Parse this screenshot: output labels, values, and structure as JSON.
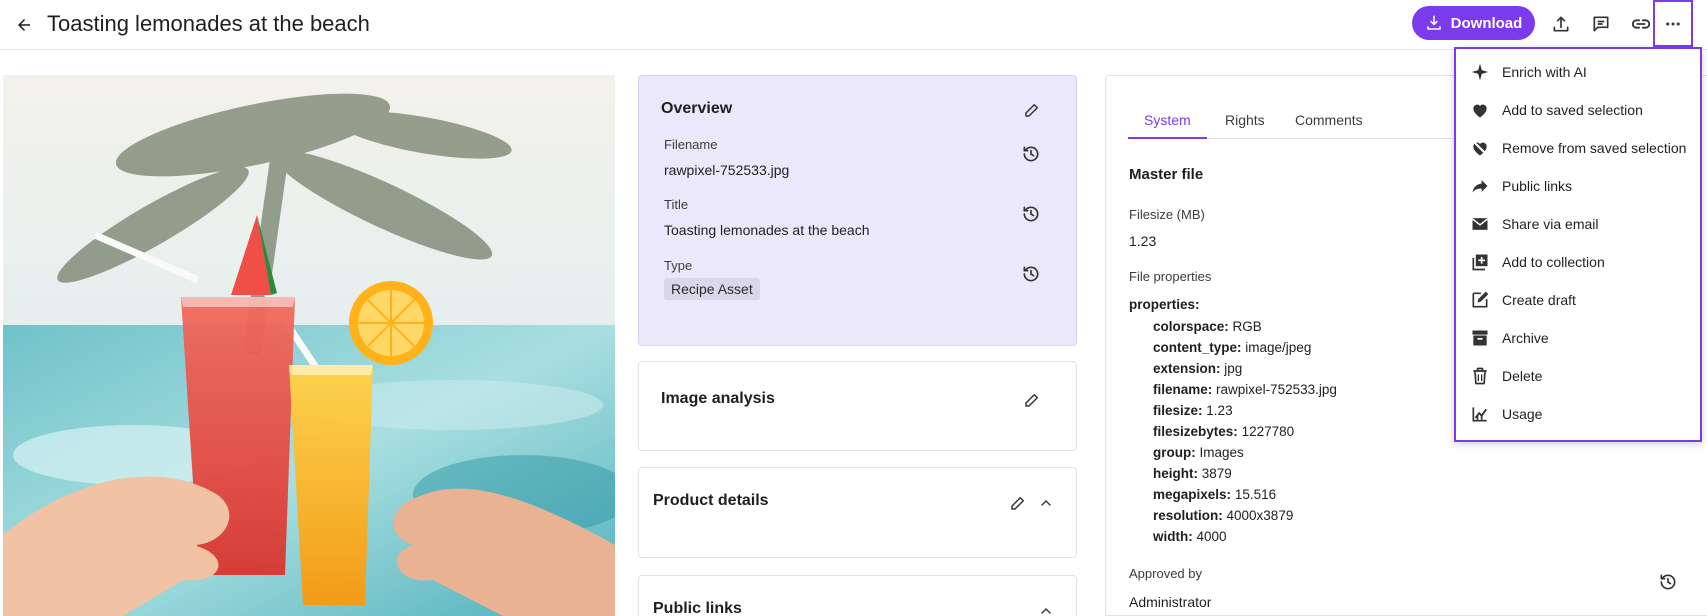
{
  "header": {
    "title": "Toasting lemonades at the beach",
    "download_label": "Download"
  },
  "overview": {
    "title": "Overview",
    "filename_label": "Filename",
    "filename_value": "rawpixel-752533.jpg",
    "title_label": "Title",
    "title_value": "Toasting lemonades at the beach",
    "type_label": "Type",
    "type_value": "Recipe Asset"
  },
  "image_analysis": {
    "title": "Image analysis"
  },
  "product_details": {
    "title": "Product details"
  },
  "public_links_card": {
    "title": "Public links"
  },
  "panel": {
    "tabs": [
      {
        "label": "System",
        "active": true
      },
      {
        "label": "Rights",
        "active": false
      },
      {
        "label": "Comments",
        "active": false
      }
    ],
    "master_file_title": "Master file",
    "filesize_label": "Filesize (MB)",
    "filesize_value": "1.23",
    "file_properties_label": "File properties",
    "properties_heading": "properties:",
    "properties": [
      {
        "key": "colorspace:",
        "value": "RGB"
      },
      {
        "key": "content_type:",
        "value": "image/jpeg"
      },
      {
        "key": "extension:",
        "value": "jpg"
      },
      {
        "key": "filename:",
        "value": "rawpixel-752533.jpg"
      },
      {
        "key": "filesize:",
        "value": "1.23"
      },
      {
        "key": "filesizebytes:",
        "value": "1227780"
      },
      {
        "key": "group:",
        "value": "Images"
      },
      {
        "key": "height:",
        "value": "3879"
      },
      {
        "key": "megapixels:",
        "value": "15.516"
      },
      {
        "key": "resolution:",
        "value": "4000x3879"
      },
      {
        "key": "width:",
        "value": "4000"
      }
    ],
    "approved_by_label": "Approved by",
    "approved_by_value": "Administrator"
  },
  "menu": {
    "items": [
      {
        "label": "Enrich with AI",
        "icon": "sparkle-icon"
      },
      {
        "label": "Add to saved selection",
        "icon": "heart-icon"
      },
      {
        "label": "Remove from saved selection",
        "icon": "heart-off-icon"
      },
      {
        "label": "Public links",
        "icon": "share-arrow-icon"
      },
      {
        "label": "Share via email",
        "icon": "email-icon"
      },
      {
        "label": "Add to collection",
        "icon": "collection-add-icon"
      },
      {
        "label": "Create draft",
        "icon": "edit-icon"
      },
      {
        "label": "Archive",
        "icon": "archive-icon"
      },
      {
        "label": "Delete",
        "icon": "trash-icon"
      },
      {
        "label": "Usage",
        "icon": "usage-chart-icon"
      }
    ]
  },
  "colors": {
    "accent": "#7c3aed",
    "overview_bg": "#ece8fb",
    "chip_bg": "#dcd6ea"
  }
}
